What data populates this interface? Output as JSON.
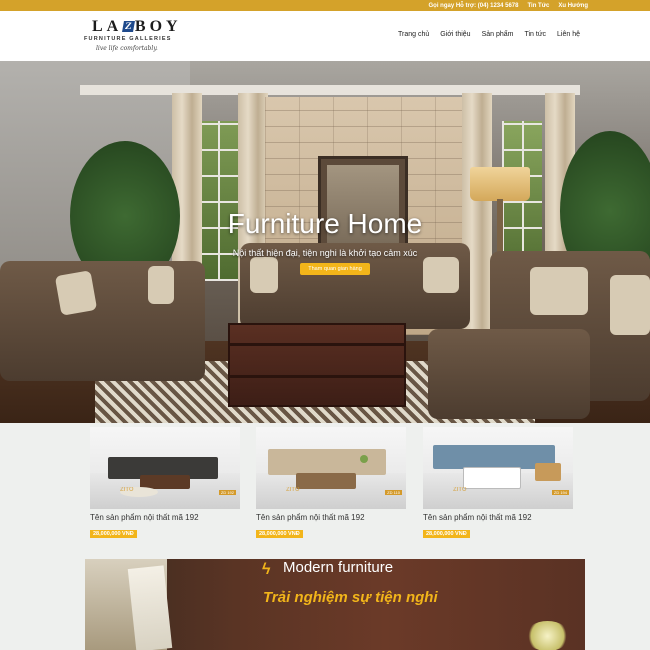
{
  "topbar": {
    "hotline": "Gọi ngay Hỗ trợ: (04) 1234 5678",
    "news_link": "Tin Tức",
    "guide_link": "Xu Hướng"
  },
  "logo": {
    "main_left": "LA",
    "main_mark": "Z",
    "main_right": "BOY",
    "sub": "FURNITURE GALLERIES",
    "tagline": "live life comfortably."
  },
  "nav": {
    "items": [
      "Trang chủ",
      "Giới thiệu",
      "Sản phẩm",
      "Tin tức",
      "Liên hệ"
    ]
  },
  "hero": {
    "title": "Furniture Home",
    "subtitle": "Nội thất hiện đại, tiện nghi là khởi tạo cảm xúc",
    "button": "Tham quan gian hàng"
  },
  "products": [
    {
      "name": "Tên sản phẩm nội thất mã 192",
      "price": "28,000,000 VNĐ",
      "brand": "ZITO",
      "tag": "ZD 192",
      "color": "#3b3a38"
    },
    {
      "name": "Tên sản phẩm nội thất mã 192",
      "price": "28,000,000 VNĐ",
      "brand": "ZITO",
      "tag": "ZD 110",
      "color": "#c9b79a"
    },
    {
      "name": "Tên sản phẩm nội thất mã 192",
      "price": "28,000,000 VNĐ",
      "brand": "ZITO",
      "tag": "ZD 194",
      "color": "#6f8fa8"
    }
  ],
  "banner": {
    "title": "Modern furniture",
    "tagline": "Trải nghiệm sự tiện nghi"
  },
  "colors": {
    "accent": "#f2b51a",
    "topbar": "#d4a22a"
  }
}
